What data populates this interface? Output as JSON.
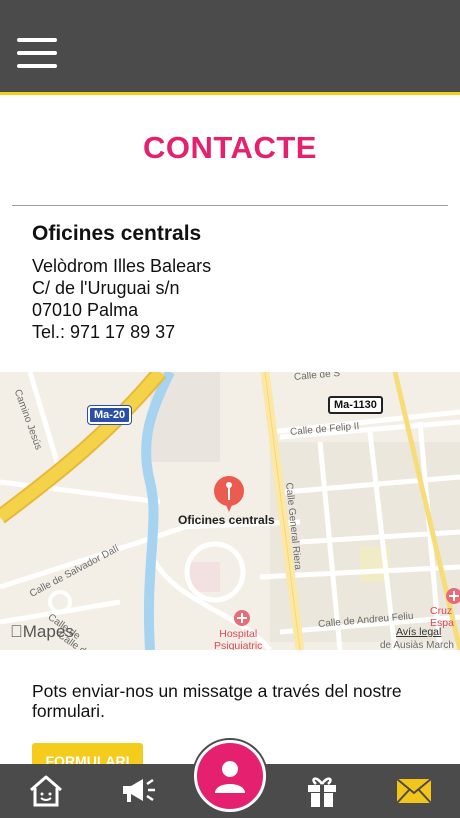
{
  "header": {
    "menu_icon": "hamburger-menu-icon"
  },
  "page": {
    "title": "CONTACTE"
  },
  "office": {
    "name": "Oficines centrals",
    "address_line1": "Velòdrom Illes Balears",
    "address_line2": "C/ de l'Uruguai s/n",
    "address_line3": "07010 Palma",
    "phone": "Tel.:  971 17 89 37"
  },
  "map": {
    "pin_label": "Oficines centrals",
    "road_ma20": "Ma-20",
    "road_ma1130": "Ma-1130",
    "streets": {
      "camino_jesus": "Camino Jesús",
      "calle_top": "Calle de S",
      "calle_felip": "Calle de Felip II",
      "calle_general_riera": "Calle General Riera",
      "calle_salvador_dali": "Calle de Salvador Dalí",
      "calle_andreu_feliu": "Calle de Andreu Feliu",
      "calle_bottom_left": "Calle de",
      "calle_bottom_left2": "Calle de Arc",
      "calle_ausias": "de Ausiàs March"
    },
    "hospital_label_line1": "Hospital",
    "hospital_label_line2": "Psiquiatric",
    "cruz_label_line1": "Cruz",
    "cruz_label_line2": "Espa",
    "legal": "Avís legal",
    "brand": "Mapes",
    "colors": {
      "pin": "#ec5b4f",
      "road_major": "#f4d34b",
      "water": "#a6d3f0"
    }
  },
  "form": {
    "text": "Pots enviar-nos un missatge a través del nostre formulari.",
    "button_label": "FORMULARI"
  },
  "tabbar": {
    "items": [
      {
        "name": "home",
        "icon": "home-icon"
      },
      {
        "name": "news",
        "icon": "megaphone-icon"
      },
      {
        "name": "profile",
        "icon": "user-icon"
      },
      {
        "name": "gifts",
        "icon": "gift-icon"
      },
      {
        "name": "contact",
        "icon": "mail-icon"
      }
    ]
  },
  "colors": {
    "accent": "#e5216f",
    "yellow": "#f3d21d",
    "bar": "#4b4b4b"
  }
}
